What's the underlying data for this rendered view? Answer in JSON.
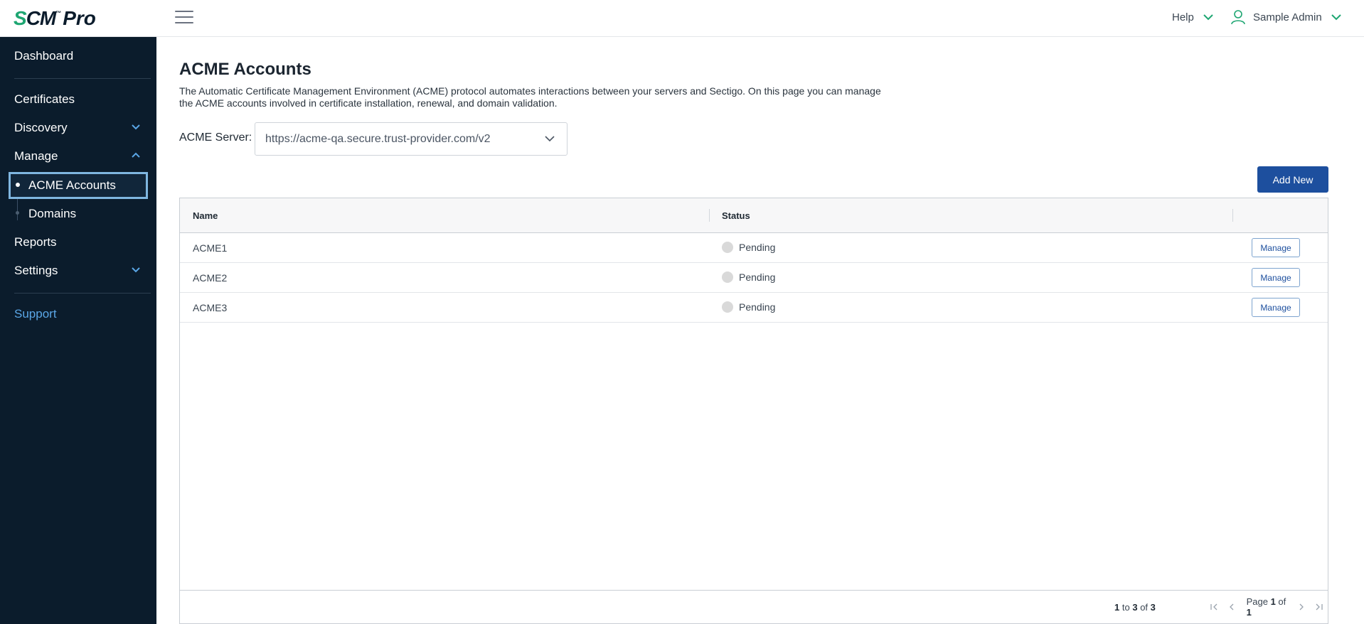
{
  "app": {
    "logo_s": "S",
    "logo_cm": "CM",
    "logo_tm": "™",
    "logo_pro": "Pro"
  },
  "header": {
    "help_label": "Help",
    "user_label": "Sample Admin",
    "accent_color": "#1ea672"
  },
  "sidebar": {
    "items": [
      {
        "label": "Dashboard"
      },
      {
        "label": "Certificates"
      },
      {
        "label": "Discovery"
      },
      {
        "label": "Manage"
      },
      {
        "label": "ACME Accounts"
      },
      {
        "label": "Domains"
      },
      {
        "label": "Reports"
      },
      {
        "label": "Settings"
      },
      {
        "label": "Support"
      }
    ],
    "active_item": "ACME Accounts",
    "background": "#0b1c2c",
    "link_color": "#5aa6e6"
  },
  "main": {
    "title": "ACME Accounts",
    "description": "The Automatic Certificate Management Environment (ACME) protocol automates interactions between your servers and Sectigo. On this page you can manage the ACME accounts involved in certificate installation, renewal, and domain validation.",
    "server_label": "ACME Server:",
    "server_value": "https://acme-qa.secure.trust-provider.com/v2",
    "add_new_label": "Add New",
    "primary_color": "#1d4f9e"
  },
  "grid": {
    "columns": [
      {
        "label": "Name"
      },
      {
        "label": "Status"
      },
      {
        "label": ""
      }
    ],
    "rows": [
      {
        "name": "ACME1",
        "status": "Pending",
        "action": "Manage"
      },
      {
        "name": "ACME2",
        "status": "Pending",
        "action": "Manage"
      },
      {
        "name": "ACME3",
        "status": "Pending",
        "action": "Manage"
      }
    ],
    "footer": {
      "from": "1",
      "to_word": "to",
      "to": "3",
      "of_word": "of",
      "total": "3",
      "page_word": "Page",
      "page": "1",
      "page_of_word": "of",
      "pages": "1"
    }
  }
}
